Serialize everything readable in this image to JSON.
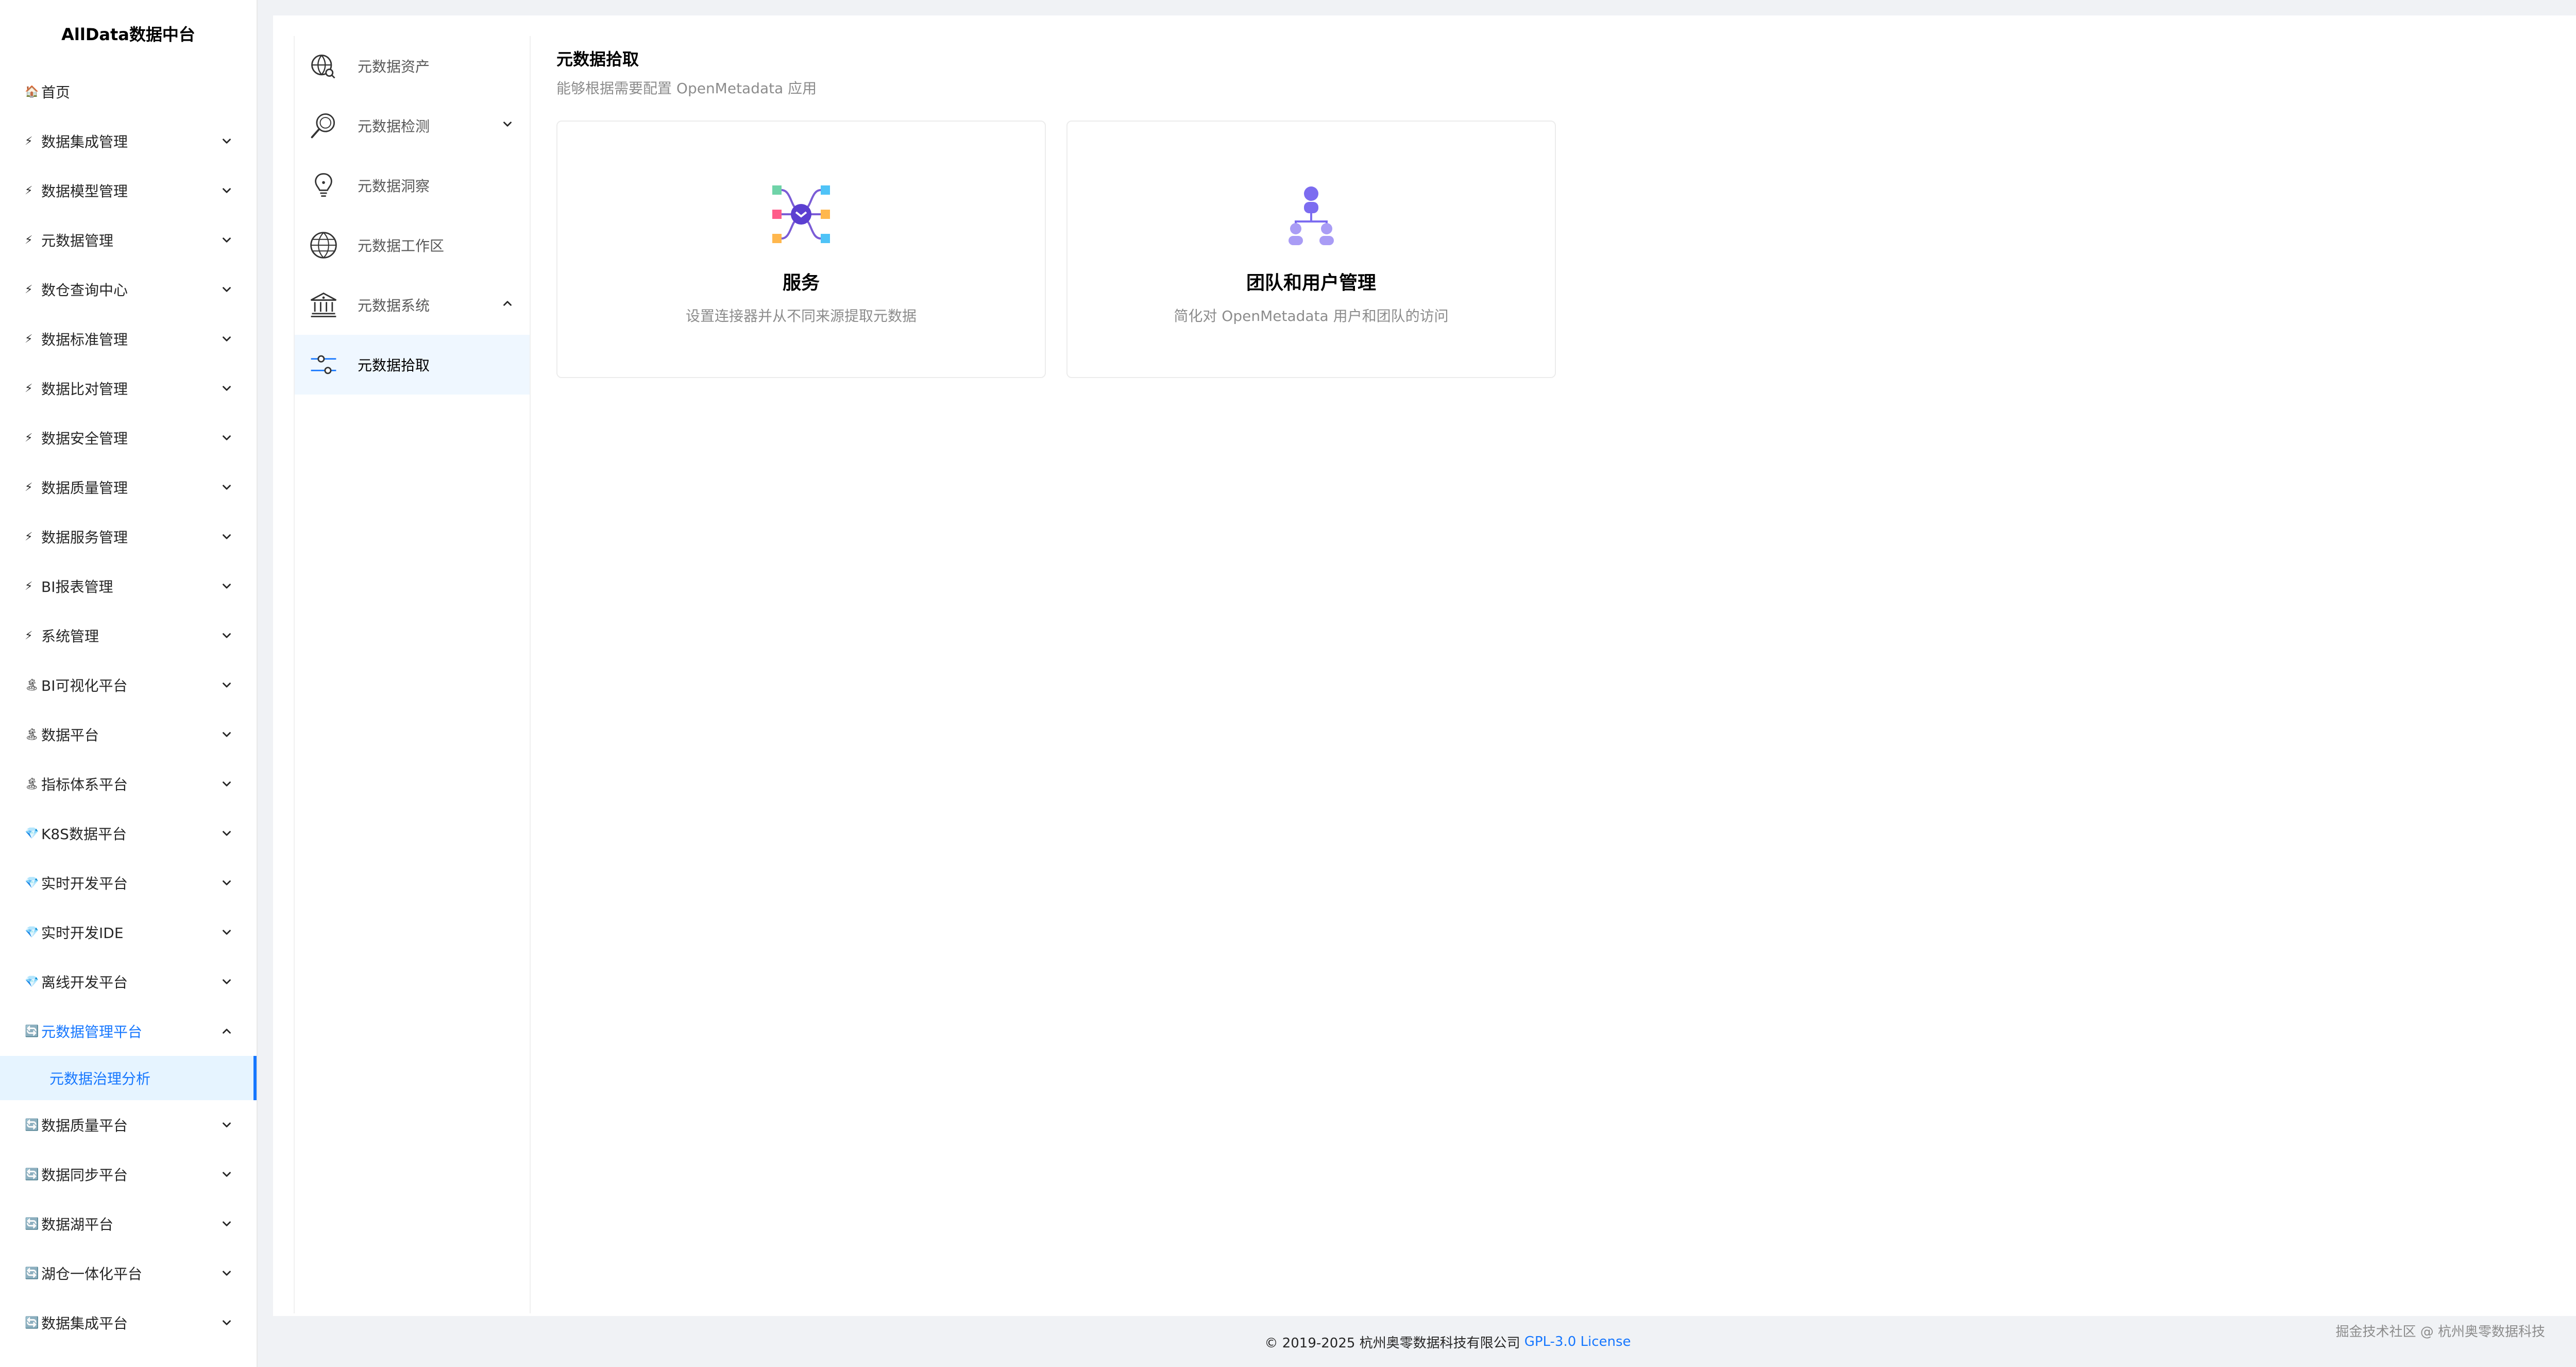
{
  "brand": "AllData数据中台",
  "sidebar": {
    "items": [
      {
        "icon": "home-icon",
        "glyph": "🏠",
        "label": "首页",
        "expandable": false
      },
      {
        "icon": "lightning-icon",
        "glyph": "⚡",
        "label": "数据集成管理",
        "expandable": true
      },
      {
        "icon": "lightning-icon",
        "glyph": "⚡",
        "label": "数据模型管理",
        "expandable": true
      },
      {
        "icon": "lightning-icon",
        "glyph": "⚡",
        "label": "元数据管理",
        "expandable": true
      },
      {
        "icon": "lightning-icon",
        "glyph": "⚡",
        "label": "数仓查询中心",
        "expandable": true
      },
      {
        "icon": "lightning-icon",
        "glyph": "⚡",
        "label": "数据标准管理",
        "expandable": true
      },
      {
        "icon": "lightning-icon",
        "glyph": "⚡",
        "label": "数据比对管理",
        "expandable": true
      },
      {
        "icon": "lightning-icon",
        "glyph": "⚡",
        "label": "数据安全管理",
        "expandable": true
      },
      {
        "icon": "lightning-icon",
        "glyph": "⚡",
        "label": "数据质量管理",
        "expandable": true
      },
      {
        "icon": "lightning-icon",
        "glyph": "⚡",
        "label": "数据服务管理",
        "expandable": true
      },
      {
        "icon": "lightning-icon",
        "glyph": "⚡",
        "label": "BI报表管理",
        "expandable": true
      },
      {
        "icon": "lightning-icon",
        "glyph": "⚡",
        "label": "系统管理",
        "expandable": true
      },
      {
        "icon": "palm-tree-icon",
        "glyph": "🏝",
        "label": "BI可视化平台",
        "expandable": true
      },
      {
        "icon": "palm-tree-icon",
        "glyph": "🏝",
        "label": "数据平台",
        "expandable": true
      },
      {
        "icon": "palm-tree-icon",
        "glyph": "🏝",
        "label": "指标体系平台",
        "expandable": true
      },
      {
        "icon": "gem-icon",
        "glyph": "💎",
        "label": "K8S数据平台",
        "expandable": true
      },
      {
        "icon": "gem-icon",
        "glyph": "💎",
        "label": "实时开发平台",
        "expandable": true
      },
      {
        "icon": "gem-icon",
        "glyph": "💎",
        "label": "实时开发IDE",
        "expandable": true
      },
      {
        "icon": "gem-icon",
        "glyph": "💎",
        "label": "离线开发平台",
        "expandable": true
      },
      {
        "icon": "cycle-icon",
        "glyph": "🔄",
        "label": "元数据管理平台",
        "expandable": true,
        "open": true,
        "children": [
          {
            "label": "元数据治理分析",
            "active": true
          }
        ]
      },
      {
        "icon": "cycle-icon",
        "glyph": "🔄",
        "label": "数据质量平台",
        "expandable": true
      },
      {
        "icon": "cycle-icon",
        "glyph": "🔄",
        "label": "数据同步平台",
        "expandable": true
      },
      {
        "icon": "cycle-icon",
        "glyph": "🔄",
        "label": "数据湖平台",
        "expandable": true
      },
      {
        "icon": "cycle-icon",
        "glyph": "🔄",
        "label": "湖仓一体化平台",
        "expandable": true
      },
      {
        "icon": "cycle-icon",
        "glyph": "🔄",
        "label": "数据集成平台",
        "expandable": true
      }
    ]
  },
  "inner_nav": {
    "items": [
      {
        "icon": "globe-search-icon",
        "label": "元数据资产"
      },
      {
        "icon": "magnifier-icon",
        "label": "元数据检测",
        "chevron": "down"
      },
      {
        "icon": "lightbulb-icon",
        "label": "元数据洞察"
      },
      {
        "icon": "globe-icon",
        "label": "元数据工作区"
      },
      {
        "icon": "bank-icon",
        "label": "元数据系统",
        "chevron": "up"
      },
      {
        "icon": "sliders-icon",
        "label": "元数据拾取",
        "active": true
      }
    ]
  },
  "main": {
    "title": "元数据拾取",
    "subtitle": "能够根据需要配置 OpenMetadata 应用",
    "cards": [
      {
        "icon": "services-hub-icon",
        "title": "服务",
        "description": "设置连接器并从不同来源提取元数据"
      },
      {
        "icon": "team-users-icon",
        "title": "团队和用户管理",
        "description": "简化对 OpenMetadata 用户和团队的访问"
      }
    ]
  },
  "footer": {
    "copyright": "© 2019-2025 杭州奥零数据科技有限公司",
    "license": "GPL-3.0 License"
  },
  "watermark": "掘金技术社区 @ 杭州奥零数据科技",
  "colors": {
    "accent": "#1677ff",
    "active_bg": "#e6f4ff",
    "page_bg": "#f0f2f5"
  }
}
